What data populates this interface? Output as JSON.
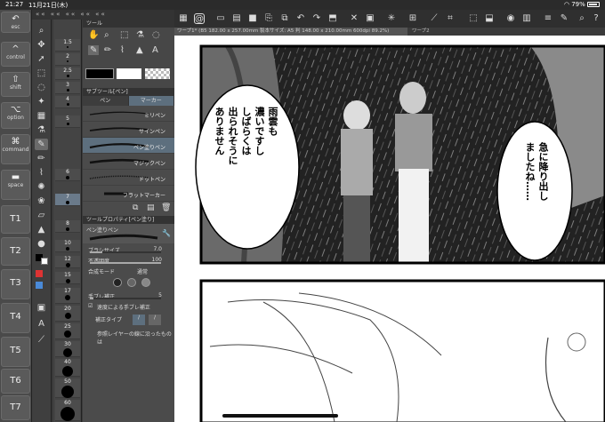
{
  "status": {
    "time": "21:27",
    "date": "11月21日(木)",
    "battery": "79%"
  },
  "edge_keys": [
    {
      "label": "esc",
      "glyph": "↶"
    },
    {
      "label": "control",
      "glyph": "^"
    },
    {
      "label": "shift",
      "glyph": "⇧"
    },
    {
      "label": "option",
      "glyph": "⌥"
    },
    {
      "label": "command",
      "glyph": "⌘"
    },
    {
      "label": "space",
      "glyph": "▬"
    },
    {
      "label": "T1"
    },
    {
      "label": "T2"
    },
    {
      "label": "T3"
    },
    {
      "label": "T4"
    },
    {
      "label": "T5"
    },
    {
      "label": "T6"
    },
    {
      "label": "T7"
    }
  ],
  "size_values": [
    "1.5",
    "2",
    "2.5",
    "3",
    "4",
    "5",
    "6",
    "7",
    "8",
    "10",
    "12",
    "15",
    "17",
    "20",
    "25",
    "30",
    "40",
    "50",
    "60",
    "70"
  ],
  "sub_tool": {
    "header": "サブツール[ペン]",
    "tabs": [
      "ペン",
      "マーカー"
    ],
    "brushes": [
      {
        "name": "ミリペン"
      },
      {
        "name": "サインペン"
      },
      {
        "name": "ペン塗りペン"
      },
      {
        "name": "マジックペン"
      },
      {
        "name": "ドットペン"
      },
      {
        "name": "フラットマーカー"
      }
    ],
    "selected": "ペン塗りペン"
  },
  "tool_property": {
    "header": "ツールプロパティ[ペン塗り]",
    "brush_name": "ペン塗りペン",
    "brush_size_label": "ブラシサイズ",
    "brush_size_value": "7.0",
    "opacity_label": "不透明度",
    "opacity_value": "100",
    "blend_label": "合成モード",
    "blend_value": "通常",
    "stab_label": "手ブレ補正",
    "stab_value": "5",
    "speed_label": "速度による手ブレ補正",
    "correction_label": "補正タイプ",
    "ref_label": "参照レイヤーの線に沿ったものは"
  },
  "document": {
    "tab1": "ワープ1* (B5 182.00 x 257.00mm 製本サイズ: A5 判 148.00 x 210.00mm 600dpi 89.2%)",
    "tab2": "ワープ2"
  },
  "manga": {
    "bubble_left": [
      "雨雲も",
      "濃いですし",
      "",
      "しばらくは",
      "出られそうに",
      "ありません"
    ],
    "bubble_right": [
      "急に降り出し",
      "ましたね……"
    ]
  },
  "colors": {
    "accent": "#5d6f7e",
    "panel": "#4b4b4b",
    "dark": "#2f2f2f"
  }
}
